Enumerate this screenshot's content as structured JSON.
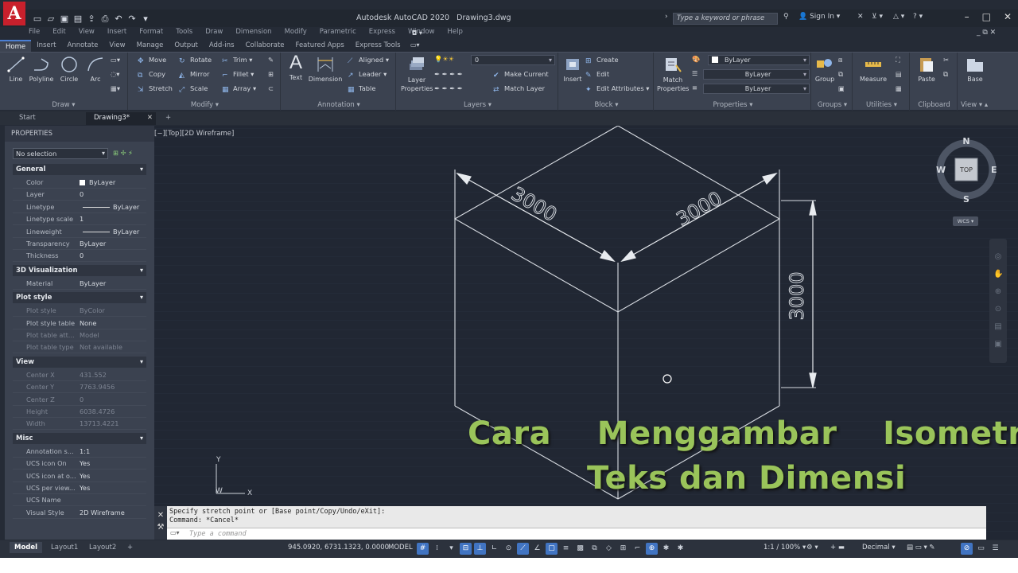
{
  "app": {
    "logo": "A",
    "title": "Autodesk AutoCAD 2020",
    "file": "Drawing3.dwg",
    "search_placeholder": "Type a keyword or phrase",
    "sign_in": "Sign In"
  },
  "menu": [
    "File",
    "Edit",
    "View",
    "Insert",
    "Format",
    "Tools",
    "Draw",
    "Dimension",
    "Modify",
    "Parametric",
    "Express",
    "Window",
    "Help"
  ],
  "ribbon_tabs": [
    "Home",
    "Insert",
    "Annotate",
    "View",
    "Manage",
    "Output",
    "Add-ins",
    "Collaborate",
    "Featured Apps",
    "Express Tools"
  ],
  "ribbon": {
    "draw": {
      "label": "Draw",
      "line": "Line",
      "polyline": "Polyline",
      "circle": "Circle",
      "arc": "Arc"
    },
    "modify": {
      "label": "Modify",
      "move": "Move",
      "rotate": "Rotate",
      "trim": "Trim",
      "copy": "Copy",
      "mirror": "Mirror",
      "fillet": "Fillet",
      "stretch": "Stretch",
      "scale": "Scale",
      "array": "Array"
    },
    "annotation": {
      "label": "Annotation",
      "text": "Text",
      "dimension": "Dimension",
      "aligned": "Aligned",
      "leader": "Leader",
      "table": "Table"
    },
    "layers": {
      "label": "Layers",
      "layer_properties": "Layer\nProperties",
      "current": "0",
      "make_current": "Make Current",
      "match_layer": "Match Layer"
    },
    "block": {
      "label": "Block",
      "insert": "Insert",
      "create": "Create",
      "edit": "Edit",
      "edit_attributes": "Edit Attributes"
    },
    "properties": {
      "label": "Properties",
      "match": "Match\nProperties",
      "color": "ByLayer",
      "linetype": "ByLayer",
      "lineweight": "ByLayer"
    },
    "groups": {
      "label": "Groups",
      "group": "Group"
    },
    "utilities": {
      "label": "Utilities",
      "measure": "Measure"
    },
    "clipboard": {
      "label": "Clipboard",
      "paste": "Paste"
    },
    "view": {
      "label": "View",
      "base": "Base"
    }
  },
  "doc_tabs": [
    "Start",
    "Drawing3*"
  ],
  "properties": {
    "title": "PROPERTIES",
    "selection": "No selection",
    "sections": [
      {
        "name": "General",
        "rows": [
          [
            "Color",
            "ByLayer"
          ],
          [
            "Layer",
            "0"
          ],
          [
            "Linetype",
            "ByLayer"
          ],
          [
            "Linetype scale",
            "1"
          ],
          [
            "Lineweight",
            "ByLayer"
          ],
          [
            "Transparency",
            "ByLayer"
          ],
          [
            "Thickness",
            "0"
          ]
        ]
      },
      {
        "name": "3D Visualization",
        "rows": [
          [
            "Material",
            "ByLayer"
          ]
        ]
      },
      {
        "name": "Plot style",
        "rows": [
          [
            "Plot style",
            "ByColor"
          ],
          [
            "Plot style table",
            "None"
          ],
          [
            "Plot table att...",
            "Model"
          ],
          [
            "Plot table type",
            "Not available"
          ]
        ]
      },
      {
        "name": "View",
        "rows": [
          [
            "Center X",
            "431.552"
          ],
          [
            "Center Y",
            "7763.9456"
          ],
          [
            "Center Z",
            "0"
          ],
          [
            "Height",
            "6038.4726"
          ],
          [
            "Width",
            "13713.4221"
          ]
        ]
      },
      {
        "name": "Misc",
        "rows": [
          [
            "Annotation s...",
            "1:1"
          ],
          [
            "UCS icon On",
            "Yes"
          ],
          [
            "UCS icon at o...",
            "Yes"
          ],
          [
            "UCS per view...",
            "Yes"
          ],
          [
            "UCS Name",
            ""
          ],
          [
            "Visual Style",
            "2D Wireframe"
          ]
        ]
      }
    ]
  },
  "viewport": {
    "label": "[−][Top][2D Wireframe]",
    "dim_left": "3000",
    "dim_right": "3000",
    "dim_vertical": "3000",
    "ucs_x": "X",
    "ucs_y": "Y",
    "ucs_w": "W"
  },
  "viewcube": {
    "n": "N",
    "s": "S",
    "e": "E",
    "w": "W",
    "top": "TOP",
    "wcs": "WCS"
  },
  "command": {
    "line1": "Specify stretch point or [Base point/Copy/Undo/eXit]:",
    "line2": "Command: *Cancel*",
    "placeholder": "Type a command"
  },
  "status": {
    "layouts": [
      "Model",
      "Layout1",
      "Layout2"
    ],
    "coords": "945.0920, 6731.1323, 0.0000",
    "model": "MODEL",
    "scale": "1:1 / 100%",
    "units": "Decimal"
  },
  "overlay": {
    "line1": "Cara    Menggambar    Isometric,",
    "line2": "Teks dan Dimensi"
  }
}
